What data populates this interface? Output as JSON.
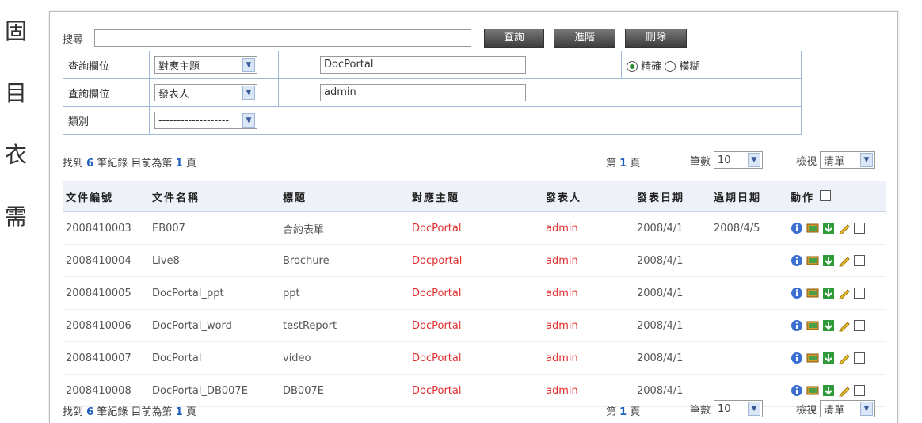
{
  "side_chars": [
    "固",
    "目",
    "衣",
    "需"
  ],
  "search": {
    "label": "搜尋",
    "value": "",
    "buttons": [
      "查詢",
      "進階",
      "刪除"
    ]
  },
  "criteria": [
    {
      "label": "查詢欄位",
      "select": "對應主題",
      "value": "DocPortal",
      "radio": {
        "exact": "精確",
        "fuzzy": "模糊",
        "selected": "exact"
      }
    },
    {
      "label": "查詢欄位",
      "select": "發表人",
      "value": "admin"
    },
    {
      "label": "類別",
      "select": "-------------------",
      "value": ""
    }
  ],
  "pager": {
    "found_prefix": "找到",
    "found_count": "6",
    "found_mid": "筆紀錄 目前為第",
    "current_page": "1",
    "page_suffix": "頁",
    "page_prefix": "第",
    "page_num": "1",
    "page_unit": "頁",
    "size_label": "筆數",
    "size_value": "10",
    "sort_label": "檢視",
    "sort_value": "清單"
  },
  "table": {
    "headers": [
      "文件編號",
      "文件名稱",
      "標題",
      "對應主題",
      "發表人",
      "發表日期",
      "過期日期",
      "動作"
    ],
    "rows": [
      {
        "id": "2008410003",
        "name": "EB007",
        "title": "合約表單",
        "topic": "DocPortal",
        "author": "admin",
        "pub": "2008/4/1",
        "exp": "2008/4/5"
      },
      {
        "id": "2008410004",
        "name": "Live8",
        "title": "Brochure",
        "topic": "Docportal",
        "author": "admin",
        "pub": "2008/4/1",
        "exp": ""
      },
      {
        "id": "2008410005",
        "name": "DocPortal_ppt",
        "title": "ppt",
        "topic": "DocPortal",
        "author": "admin",
        "pub": "2008/4/1",
        "exp": ""
      },
      {
        "id": "2008410006",
        "name": "DocPortal_word",
        "title": "testReport",
        "topic": "DocPortal",
        "author": "admin",
        "pub": "2008/4/1",
        "exp": ""
      },
      {
        "id": "2008410007",
        "name": "DocPortal",
        "title": "video",
        "topic": "DocPortal",
        "author": "admin",
        "pub": "2008/4/1",
        "exp": ""
      },
      {
        "id": "2008410008",
        "name": "DocPortal_DB007E",
        "title": "DB007E",
        "topic": "DocPortal",
        "author": "admin",
        "pub": "2008/4/1",
        "exp": ""
      }
    ]
  },
  "colors": {
    "accent_red": "#e23030",
    "border_blue": "#9fb7d8",
    "count_blue": "#1f5fbf"
  },
  "row_action_icons": [
    "info-icon",
    "image-icon",
    "download-icon",
    "edit-pencil-icon",
    "checkbox"
  ]
}
